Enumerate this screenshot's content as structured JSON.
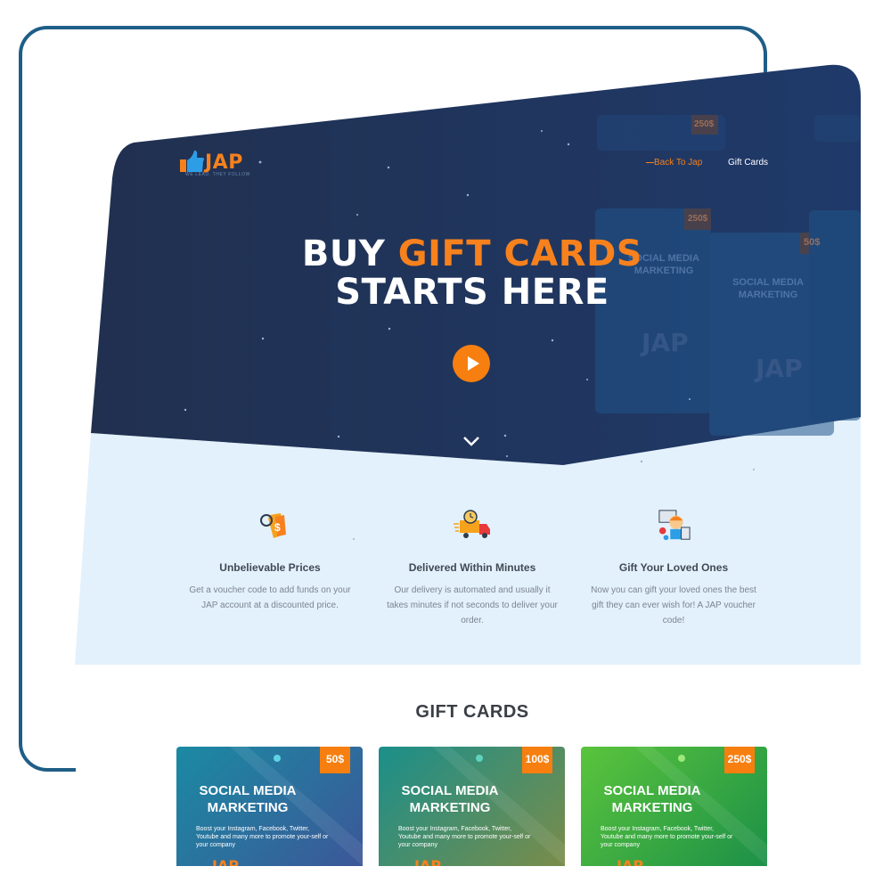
{
  "brand": {
    "name": "JAP",
    "tagline": "WE LEAD. THEY FOLLOW"
  },
  "nav": {
    "back_label": "Back To Jap",
    "gift_label": "Gift Cards"
  },
  "hero": {
    "title_pre": "BUY ",
    "title_accent": "GIFT CARDS",
    "title_line2": "STARTS HERE"
  },
  "ghost_cards": {
    "a_price": "250$",
    "b_price": "250$",
    "c_price": "50$",
    "title": "SOCIAL MEDIA MARKETING",
    "brand": "JAP"
  },
  "features": [
    {
      "icon": "price-tag-icon",
      "title": "Unbelievable Prices",
      "desc": "Get a voucher code to add funds on your JAP account at a discounted price."
    },
    {
      "icon": "delivery-truck-icon",
      "title": "Delivered Within Minutes",
      "desc": "Our delivery is automated and usually it takes minutes if not seconds to deliver your order."
    },
    {
      "icon": "gift-person-icon",
      "title": "Gift Your Loved Ones",
      "desc": "Now you can gift your loved ones the best gift they can ever wish for! A JAP voucher code!"
    }
  ],
  "gift_section": {
    "title": "GIFT CARDS"
  },
  "cards": [
    {
      "price": "50$",
      "title_1": "SOCIAL MEDIA",
      "title_2": "MARKETING",
      "desc": "Boost your Instagram, Facebook, Twitter, Youtube and many more to promote your-self or your company",
      "brand": "JAP"
    },
    {
      "price": "100$",
      "title_1": "SOCIAL MEDIA",
      "title_2": "MARKETING",
      "desc": "Boost your Instagram, Facebook, Twitter, Youtube and many more to promote your-self or your company",
      "brand": "JAP"
    },
    {
      "price": "250$",
      "title_1": "SOCIAL MEDIA",
      "title_2": "MARKETING",
      "desc": "Boost your Instagram, Facebook, Twitter, Youtube and many more to promote your-self or your company",
      "brand": "JAP"
    }
  ],
  "colors": {
    "accent": "#f7811d",
    "hero_bg": "#1f3459",
    "feature_bg": "#e3f1fc",
    "frame": "#1f5e86"
  }
}
